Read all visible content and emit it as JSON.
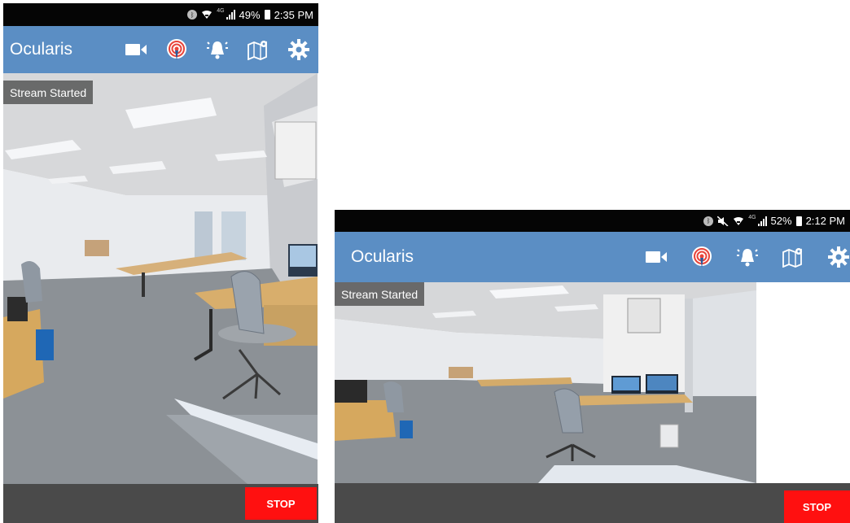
{
  "colors": {
    "appbar": "#5b8ec4",
    "statusbar": "#050505",
    "stop_button": "#ff1010",
    "bottom_bar": "#4a4a4a",
    "toast_bg": "#5a5a5a"
  },
  "portrait": {
    "status": {
      "battery": "49%",
      "time": "2:35 PM",
      "network": "4G"
    },
    "app_title": "Ocularis",
    "toolbar_icons": [
      "video-camera-icon",
      "broadcast-icon",
      "alarm-icon",
      "map-icon",
      "settings-icon"
    ],
    "toast": "Stream Started",
    "stop_label": "STOP"
  },
  "landscape": {
    "status": {
      "battery": "52%",
      "time": "2:12 PM",
      "network": "4G"
    },
    "app_title": "Ocularis",
    "toolbar_icons": [
      "video-camera-icon",
      "broadcast-icon",
      "alarm-icon",
      "map-icon",
      "settings-icon"
    ],
    "toast": "Stream Started",
    "stop_label": "STOP"
  }
}
